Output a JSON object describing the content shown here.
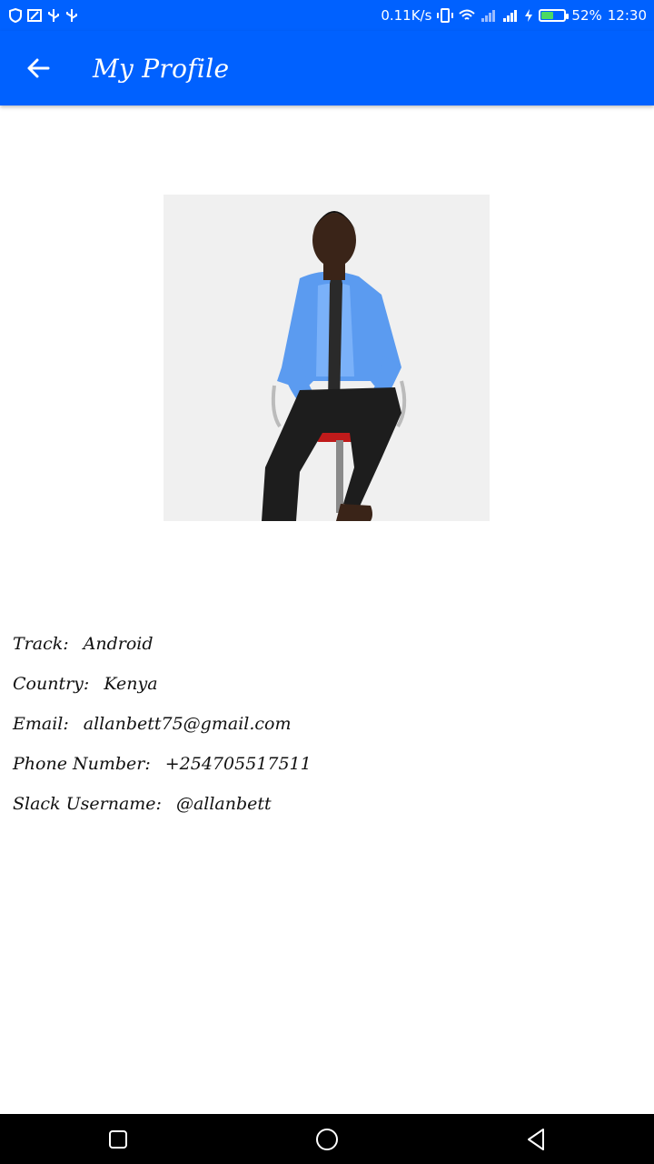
{
  "status_bar": {
    "net_speed": "0.11K/s",
    "battery_percent": "52%",
    "time": "12:30",
    "battery_level": 0.52,
    "icons": [
      "shield-icon",
      "cast-icon",
      "usb-icon",
      "usb-icon",
      "vibrate-icon",
      "wifi-icon",
      "signal-icon",
      "signal-icon",
      "charging-icon",
      "battery-icon"
    ]
  },
  "app_bar": {
    "title": "My Profile",
    "back_icon": "arrow-back-icon"
  },
  "profile": {
    "details": [
      {
        "label": "Track:",
        "value": "Android"
      },
      {
        "label": "Country:",
        "value": "Kenya"
      },
      {
        "label": "Email:",
        "value": "allanbett75@gmail.com"
      },
      {
        "label": "Phone Number:",
        "value": "+254705517511"
      },
      {
        "label": "Slack Username:",
        "value": "@allanbett"
      }
    ]
  },
  "nav_bar": {
    "icons": [
      "recents-square-icon",
      "home-circle-icon",
      "back-triangle-icon"
    ]
  },
  "colors": {
    "primary": "#0061ff",
    "background": "#ffffff",
    "text": "#111111"
  }
}
